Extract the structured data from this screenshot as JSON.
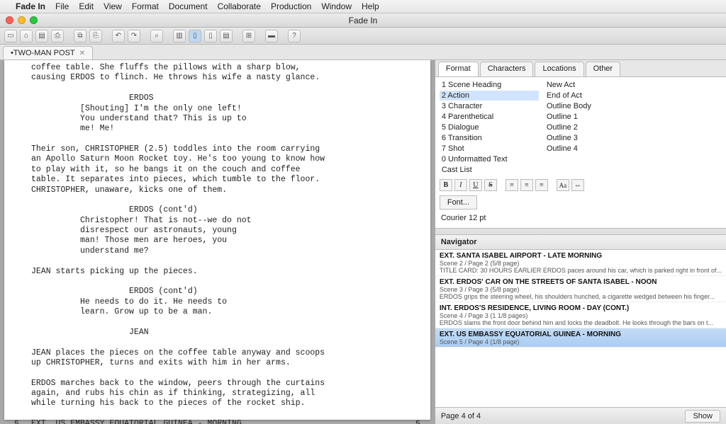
{
  "menubar": {
    "app": "Fade In",
    "items": [
      "File",
      "Edit",
      "View",
      "Format",
      "Document",
      "Collaborate",
      "Production",
      "Window",
      "Help"
    ]
  },
  "window_title": "Fade In",
  "tab": {
    "label": "•TWO-MAN POST"
  },
  "script": {
    "lines": [
      "coffee table. She fluffs the pillows with a sharp blow,",
      "causing ERDOS to flinch. He throws his wife a nasty glance.",
      "",
      "                    ERDOS",
      "          [Shouting] I'm the only one left!",
      "          You understand that? This is up to",
      "          me! Me!",
      "",
      "Their son, CHRISTOPHER (2.5) toddles into the room carrying",
      "an Apollo Saturn Moon Rocket toy. He's too young to know how",
      "to play with it, so he bangs it on the couch and coffee",
      "table. It separates into pieces, which tumble to the floor.",
      "CHRISTOPHER, unaware, kicks one of them.",
      "",
      "                    ERDOS (cont'd)",
      "          Christopher! That is not--we do not",
      "          disrespect our astronauts, young",
      "          man! Those men are heroes, you",
      "          understand me?",
      "",
      "JEAN starts picking up the pieces.",
      "",
      "                    ERDOS (cont'd)",
      "          He needs to do it. He needs to",
      "          learn. Grow up to be a man.",
      "",
      "                    JEAN",
      "",
      "JEAN places the pieces on the coffee table anyway and scoops",
      "up CHRISTOPHER, turns and exits with him in her arms.",
      "",
      "ERDOS marches back to the window, peers through the curtains",
      "again, and rubs his chin as if thinking, strategizing, all",
      "while turning his back to the pieces of the rocket ship.",
      "",
      "EXT. US EMBASSY EQUATORIAL GUINEA - MORNING"
    ],
    "scene_num": "5"
  },
  "sidepanel": {
    "tabs": [
      "Format",
      "Characters",
      "Locations",
      "Other"
    ],
    "formats_left": [
      "1 Scene Heading",
      "2 Action",
      "3 Character",
      "4 Parenthetical",
      "5 Dialogue",
      "6 Transition",
      "7 Shot",
      "0 Unformatted Text",
      "Cast List"
    ],
    "formats_right": [
      "New Act",
      "End of Act",
      "Outline Body",
      "Outline 1",
      "Outline 2",
      "Outline 3",
      "Outline 4",
      "",
      ""
    ],
    "font_button": "Font...",
    "font_current": "Courier 12 pt",
    "navigator_label": "Navigator",
    "nav": [
      {
        "scene": "EXT. SANTA ISABEL AIRPORT - LATE MORNING",
        "meta": "Scene 2 / Page 2 (5/8 page)",
        "desc": "TITLE CARD: 30 HOURS EARLIER  ERDOS paces around his car, which is parked right in front of..."
      },
      {
        "scene": "EXT. ERDOS' CAR ON THE STREETS OF SANTA ISABEL - NOON",
        "meta": "Scene 3 / Page 3 (5/8 page)",
        "desc": "ERDOS grips the steering wheel, his shoulders hunched, a cigarette wedged between his finger..."
      },
      {
        "scene": "INT. ERDOS'S RESIDENCE, LIVING ROOM - DAY (CONT.)",
        "meta": "Scene 4 / Page 3 (1 1/8 pages)",
        "desc": "ERDOS slams the front door behind him and locks the deadbolt. He looks through the bars on t..."
      },
      {
        "scene": "EXT. US EMBASSY EQUATORIAL GUINEA - MORNING",
        "meta": "Scene 5 / Page 4 (1/8 page)",
        "desc": ""
      }
    ],
    "status": "Page 4 of 4",
    "show_btn": "Show"
  }
}
